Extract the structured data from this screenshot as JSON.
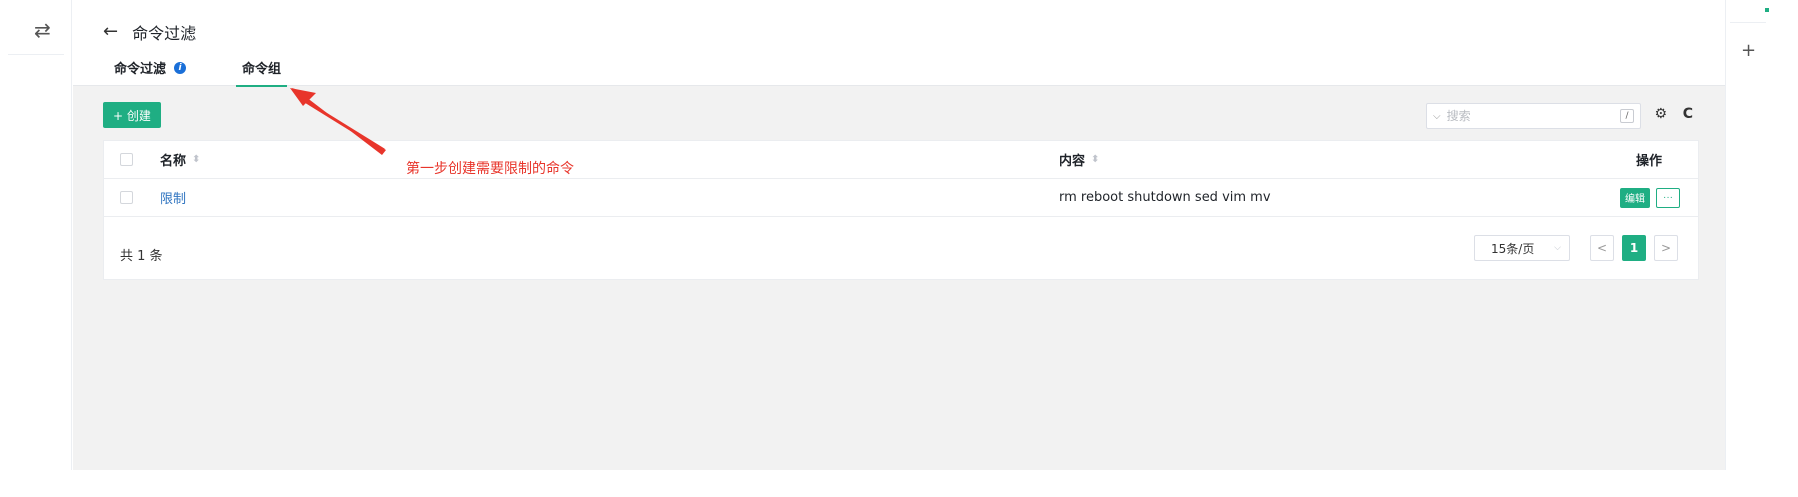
{
  "left_rail": {
    "swap_icon": "⇄"
  },
  "header": {
    "back_icon": "←",
    "title": "命令过滤",
    "tabs": [
      {
        "label": "命令过滤",
        "info_icon": "i"
      },
      {
        "label": "命令组"
      }
    ]
  },
  "toolbar": {
    "create_label": "+ 创建",
    "search_placeholder": "搜索",
    "search_shortcut": "/",
    "settings_icon": "⚙",
    "refresh_icon": "C"
  },
  "table": {
    "columns": {
      "name": "名称",
      "content": "内容",
      "actions": "操作"
    },
    "rows": [
      {
        "name": "限制",
        "content": "rm reboot shutdown sed vim mv",
        "edit_label": "编辑",
        "more_label": "···"
      }
    ]
  },
  "footer": {
    "total": "共 1 条",
    "page_size": "15条/页",
    "current_page": "1",
    "prev_icon": "<",
    "next_icon": ">"
  },
  "annotation": {
    "text": "第一步创建需要限制的命令"
  },
  "right_rail": {
    "plus_icon": "+"
  },
  "colors": {
    "accent": "#1fae83",
    "link": "#2f74c0",
    "annotation": "#e8352b"
  }
}
